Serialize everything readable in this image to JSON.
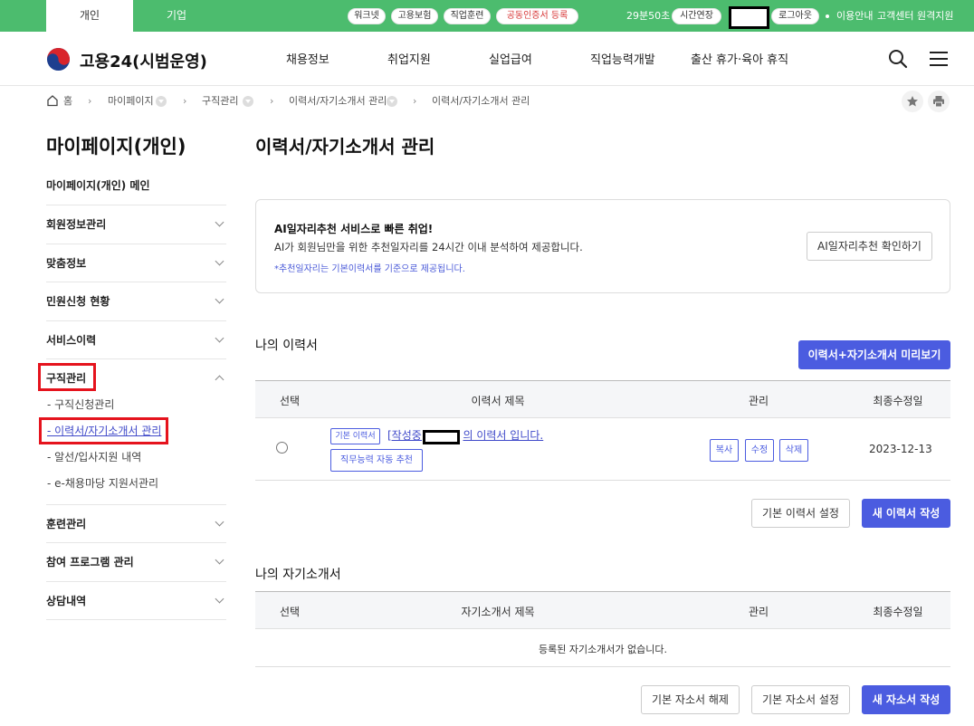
{
  "topbar": {
    "tabs": [
      {
        "label": "개인",
        "active": true
      },
      {
        "label": "기업",
        "active": false
      }
    ],
    "quick_links": [
      "워크넷",
      "고용보험",
      "직업훈련"
    ],
    "cert_register": "공동인증서 등록",
    "timer": "29분50초",
    "extend_label": "시간연장",
    "logout_label": "로그아웃",
    "links": [
      "이용안내",
      "고객센터",
      "원격지원"
    ]
  },
  "header": {
    "logo_text": "고용24(시범운영)",
    "nav": [
      "채용정보",
      "취업지원",
      "실업급여",
      "직업능력개발",
      "출산 휴가·육아 휴직"
    ]
  },
  "breadcrumb": {
    "home": "홈",
    "items": [
      "마이페이지",
      "구직관리",
      "이력서/자기소개서 관리",
      "이력서/자기소개서 관리"
    ]
  },
  "sidebar": {
    "title": "마이페이지(개인)",
    "main_item": "마이페이지(개인) 메인",
    "items": [
      {
        "label": "회원정보관리",
        "expanded": false
      },
      {
        "label": "맞춤정보",
        "expanded": false
      },
      {
        "label": "민원신청 현황",
        "expanded": false
      },
      {
        "label": "서비스이력",
        "expanded": false
      },
      {
        "label": "구직관리",
        "expanded": true
      },
      {
        "label": "훈련관리",
        "expanded": false
      },
      {
        "label": "참여 프로그램 관리",
        "expanded": false
      },
      {
        "label": "상담내역",
        "expanded": false
      }
    ],
    "sub_items": [
      {
        "label": "- 구직신청관리",
        "active": false
      },
      {
        "label": "- 이력서/자기소개서 관리",
        "active": true
      },
      {
        "label": "- 알선/입사지원 내역",
        "active": false
      },
      {
        "label": "- e-채용마당 지원서관리",
        "active": false
      }
    ]
  },
  "main": {
    "title": "이력서/자기소개서 관리",
    "ai_box": {
      "heading": "AI일자리추천 서비스로 빠른 취업!",
      "desc": "AI가 회원님만을 위한 추천일자리를 24시간 이내 분석하여 제공합니다.",
      "note": "*추천일자리는 기본이력서를 기준으로 제공됩니다.",
      "button": "AI일자리추천 확인하기"
    },
    "resume": {
      "section_title": "나의 이력서",
      "preview_button": "이력서+자기소개서 미리보기",
      "columns": [
        "선택",
        "이력서 제목",
        "관리",
        "최종수정일"
      ],
      "row": {
        "tag": "기본 이력서",
        "title_prefix": "[작성중]",
        "title_suffix": "의 이력서 입니다.",
        "auto_recommend": "직무능력 자동 추천",
        "actions": [
          "복사",
          "수정",
          "삭제"
        ],
        "date": "2023-12-13"
      },
      "set_default_button": "기본 이력서 설정",
      "new_button": "새 이력서 작성"
    },
    "intro": {
      "section_title": "나의 자기소개서",
      "columns": [
        "선택",
        "자기소개서 제목",
        "관리",
        "최종수정일"
      ],
      "empty": "등록된 자기소개서가 없습니다.",
      "unset_button": "기본 자소서 해제",
      "set_button": "기본 자소서 설정",
      "new_button": "새 자소서 작성"
    }
  },
  "colors": {
    "topbar": "#4cbc6e",
    "primary": "#4b5ce0",
    "highlight_box": "#e5131d"
  }
}
